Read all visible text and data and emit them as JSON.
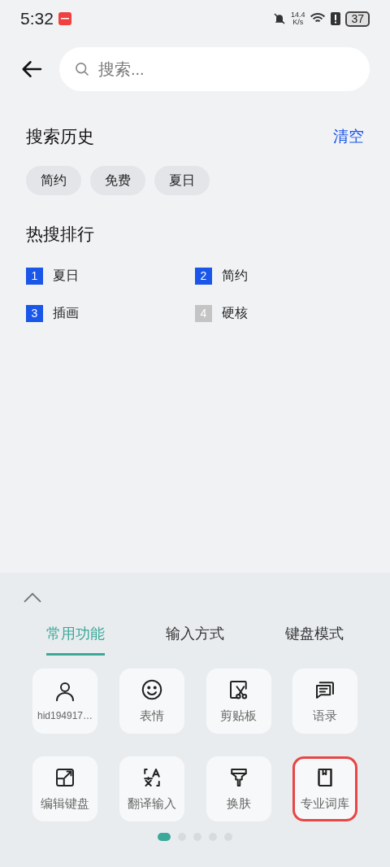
{
  "status_bar": {
    "time": "5:32",
    "net_speed_value": "14.4",
    "net_speed_unit": "K/s",
    "battery": "37"
  },
  "search": {
    "placeholder": "搜索..."
  },
  "history": {
    "title": "搜索历史",
    "clear": "清空",
    "chips": [
      "简约",
      "免费",
      "夏日"
    ]
  },
  "hot": {
    "title": "热搜排行",
    "items": [
      {
        "rank": "1",
        "label": "夏日",
        "color": "#1a56e8"
      },
      {
        "rank": "2",
        "label": "简约",
        "color": "#1a56e8"
      },
      {
        "rank": "3",
        "label": "插画",
        "color": "#1a56e8"
      },
      {
        "rank": "4",
        "label": "硬核",
        "color": "#c4c4c4"
      }
    ]
  },
  "panel": {
    "tabs": [
      {
        "label": "常用功能",
        "selected": true
      },
      {
        "label": "输入方式",
        "selected": false
      },
      {
        "label": "键盘模式",
        "selected": false
      }
    ],
    "items": [
      {
        "kind": "user",
        "label": "hid194917…",
        "highlighted": false
      },
      {
        "kind": "emoji",
        "label": "表情",
        "highlighted": false
      },
      {
        "kind": "clipboard",
        "label": "剪贴板",
        "highlighted": false
      },
      {
        "kind": "phrases",
        "label": "语录",
        "highlighted": false
      },
      {
        "kind": "edit",
        "label": "编辑键盘",
        "highlighted": false
      },
      {
        "kind": "translate",
        "label": "翻译输入",
        "highlighted": false
      },
      {
        "kind": "skin",
        "label": "换肤",
        "highlighted": false
      },
      {
        "kind": "dictionary",
        "label": "专业词库",
        "highlighted": true
      }
    ],
    "pages": [
      {
        "selected": true
      },
      {
        "selected": false
      },
      {
        "selected": false
      },
      {
        "selected": false
      },
      {
        "selected": false
      }
    ]
  }
}
